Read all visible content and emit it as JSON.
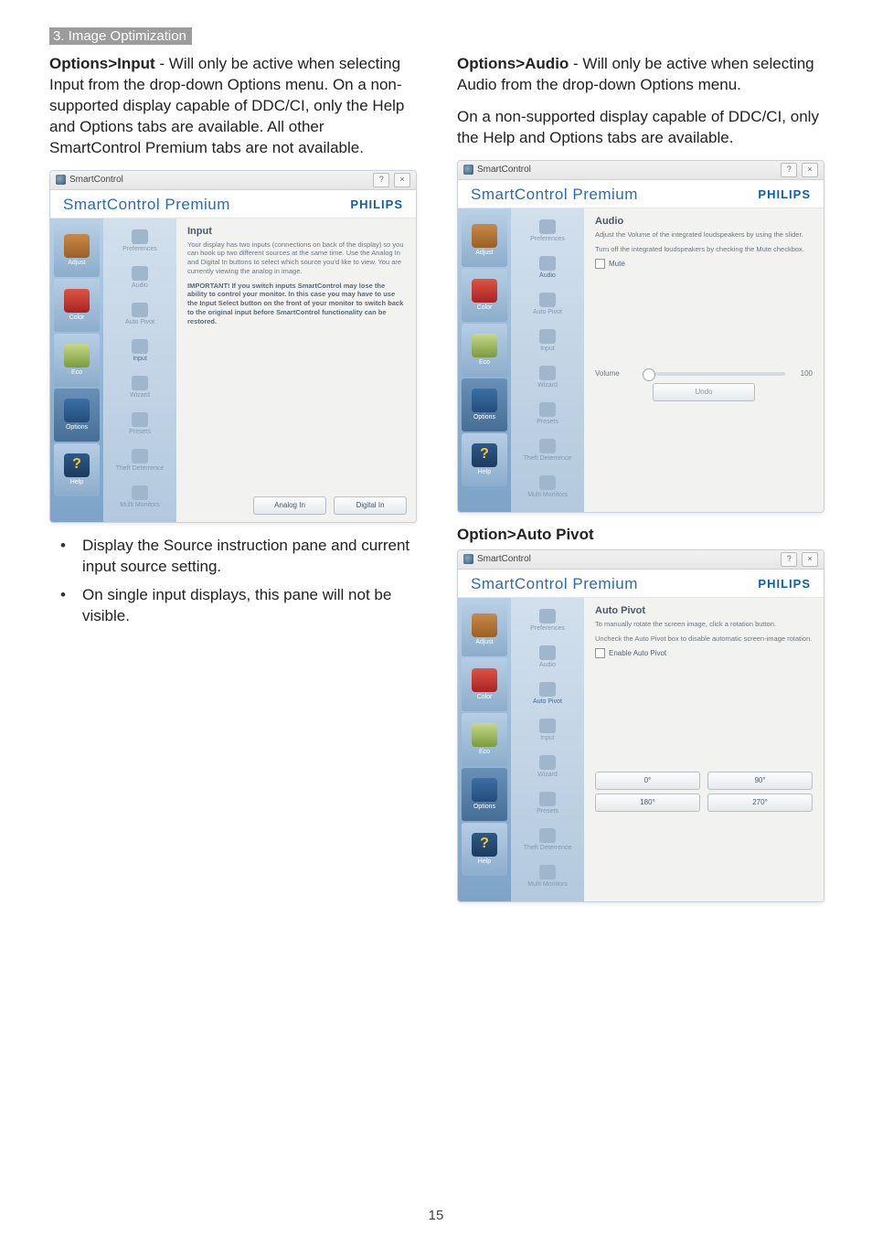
{
  "section_tag": "3. Image Optimization",
  "left": {
    "p1_bold": "Options>Input",
    "p1_rest": " - Will only be active when selecting Input from the drop-down Options menu. On a non-supported display capable of DDC/CI, only the Help and Options tabs are available. All other SmartControl Premium tabs are not available.",
    "bullets": [
      "Display the Source instruction pane and current input source setting.",
      "On single input displays, this pane will not be visible."
    ]
  },
  "right": {
    "p1_bold": "Options>Audio",
    "p1_rest": " - Will only be active when selecting Audio from the drop-down Options menu.",
    "p2": "On a non-supported display capable of DDC/CI, only the Help and Options tabs are available.",
    "sub2": "Option>Auto Pivot"
  },
  "shot_common": {
    "window_title": "SmartControl",
    "brand_left": "SmartControl Premium",
    "brand_right": "PHILIPS",
    "help_icon": "?",
    "close_icon": "×",
    "lnav": {
      "adjust": "Adjust",
      "color": "Color",
      "eco": "Eco",
      "options": "Options",
      "help": "Help"
    },
    "snav": {
      "preferences": "Preferences",
      "audio": "Audio",
      "auto_pivot": "Auto Pivot",
      "input": "Input",
      "wizard": "Wizard",
      "presets": "Presets",
      "theft": "Theft Deterrence",
      "multi": "Multi Monitors"
    }
  },
  "shot_input": {
    "title": "Input",
    "desc1": "Your display has two inputs (connections on back of the display) so you can hook up two different sources at the same time. Use the Analog In and Digital In buttons to select which source you'd like to view. You are currently viewing the analog in image.",
    "desc2": "IMPORTANT! If you switch inputs SmartControl may lose the ability to control your monitor. In this case you may have to use the Input Select button on the front of your monitor to switch back to the original input before SmartControl functionality can be restored.",
    "btn_analog": "Analog In",
    "btn_digital": "Digital In"
  },
  "shot_audio": {
    "title": "Audio",
    "desc1": "Adjust the Volume of the integrated loudspeakers by using the slider.",
    "desc2": "Turn off the integrated loudspeakers by checking the Mute checkbox.",
    "mute": "Mute",
    "volume_label": "Volume",
    "volume_max": "100",
    "undo": "Undo"
  },
  "shot_pivot": {
    "title": "Auto Pivot",
    "desc1": "To manually rotate the screen image, click a rotation button.",
    "desc2": "Uncheck the Auto Pivot box to disable automatic screen-image rotation.",
    "enable": "Enable Auto Pivot",
    "btn0": "0°",
    "btn90": "90°",
    "btn180": "180°",
    "btn270": "270°"
  },
  "page_number": "15"
}
